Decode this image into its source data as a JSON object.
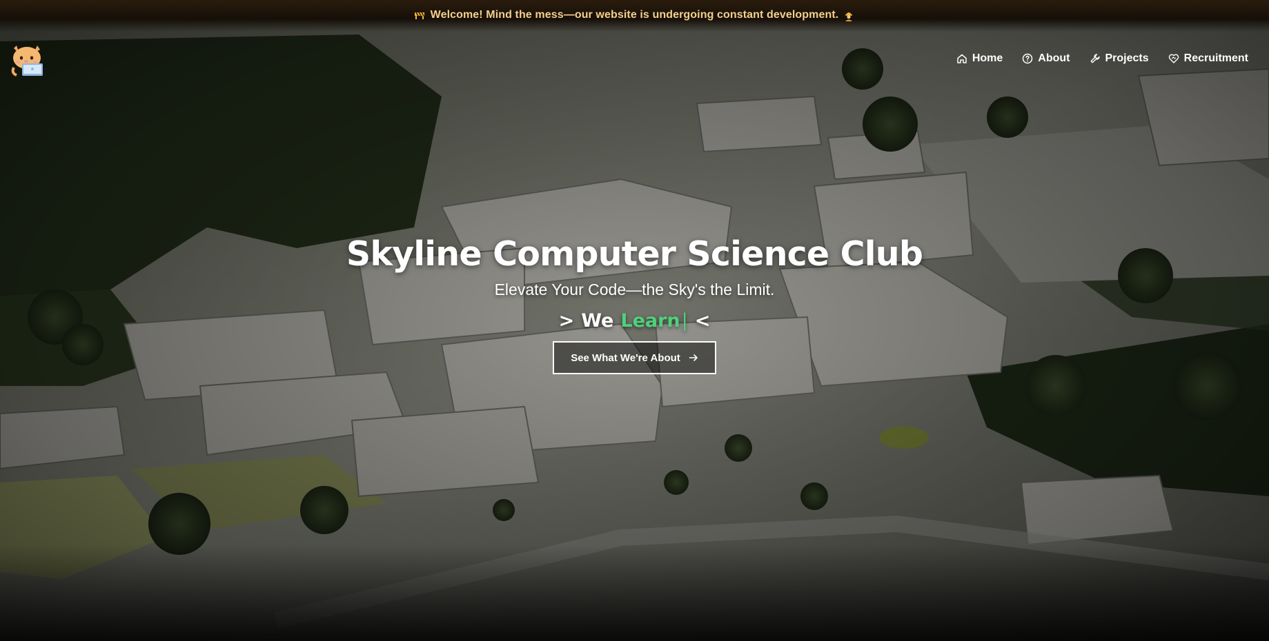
{
  "announcement": {
    "text": "Welcome! Mind the mess—our website is undergoing constant development.",
    "leading_icon": "construction-barrier-icon",
    "trailing_icon": "construction-worker-icon"
  },
  "nav": {
    "logo_icon": "cat-with-laptop-logo",
    "links": [
      {
        "label": "Home",
        "icon": "home-icon"
      },
      {
        "label": "About",
        "icon": "question-circle-icon"
      },
      {
        "label": "Projects",
        "icon": "wrench-icon"
      },
      {
        "label": "Recruitment",
        "icon": "heart-handshake-icon"
      }
    ]
  },
  "hero": {
    "title": "Skyline Computer Science Club",
    "subtitle": "Elevate Your Code—the Sky's the Limit.",
    "typer": {
      "open": ">",
      "prefix": "We",
      "word": "Learn",
      "caret": "|",
      "close": "<"
    },
    "cta": {
      "label": "See What We're About",
      "icon": "arrow-right-icon"
    }
  },
  "colors": {
    "announcement_text": "#f4cf8e",
    "announcement_bg": "#2a1c0d",
    "accent_green": "#4ed17a",
    "text": "#ffffff"
  }
}
